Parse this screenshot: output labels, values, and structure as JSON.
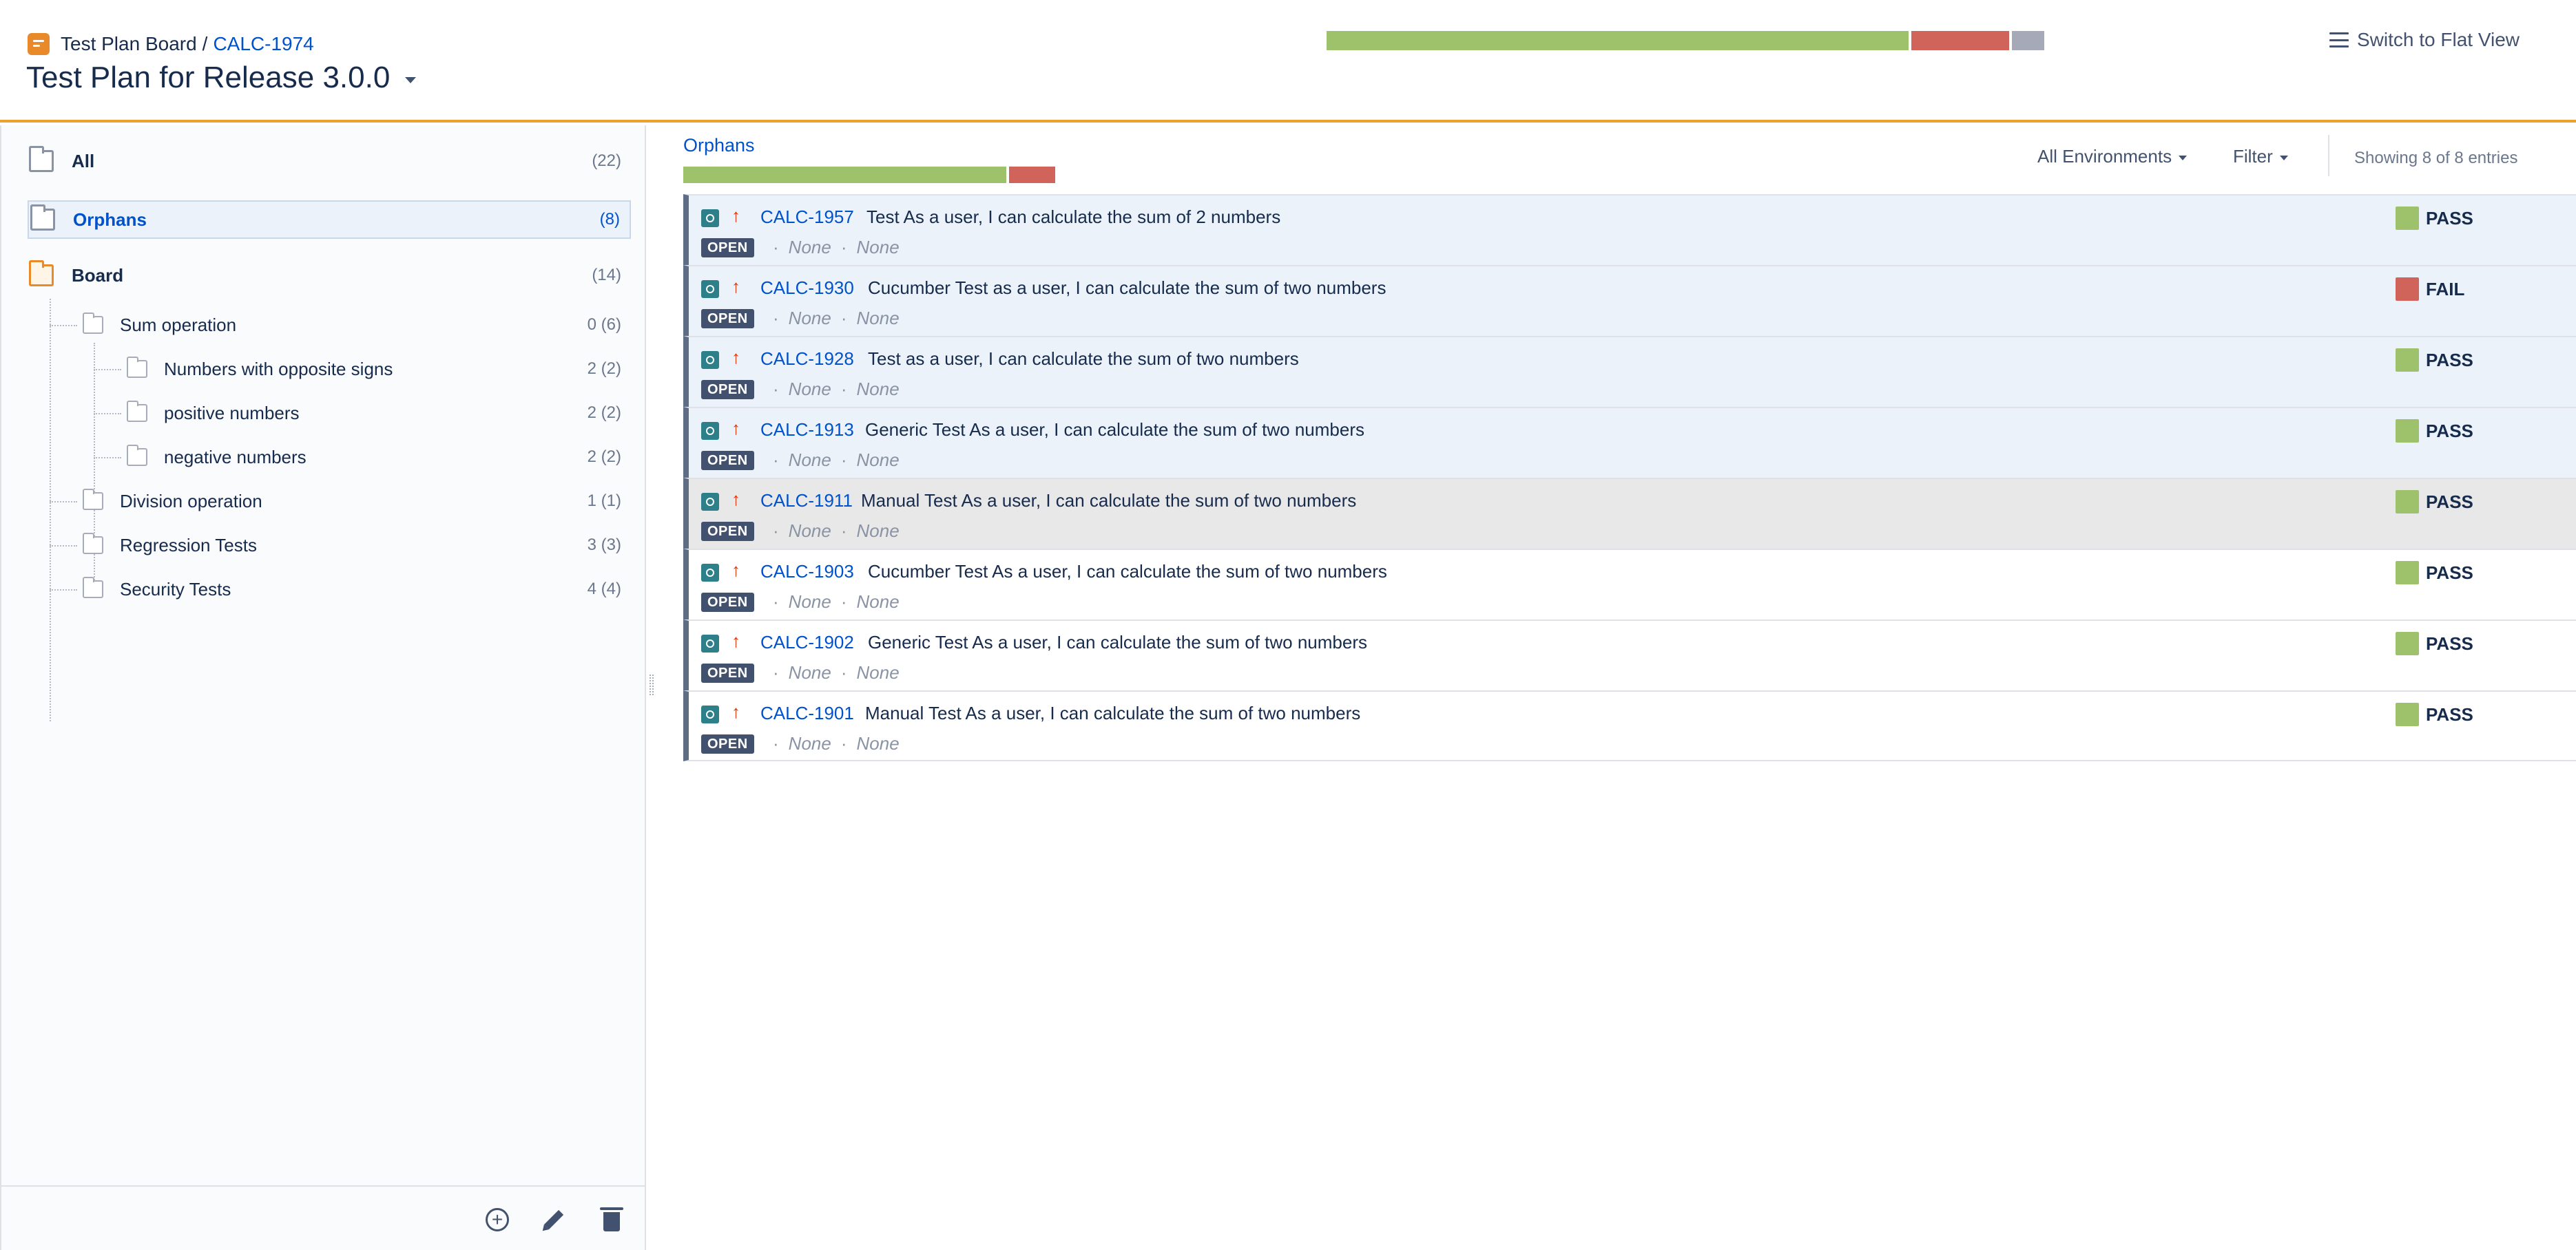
{
  "header": {
    "board_label": "Test Plan Board",
    "separator": "/",
    "issue_key": "CALC-1974",
    "plan_title": "Test Plan for Release 3.0.0",
    "flat_view_label": "Switch to Flat View",
    "progress": [
      {
        "status": "pass",
        "fraction": 0.817,
        "color": "#9ec26b"
      },
      {
        "status": "fail",
        "fraction": 0.138,
        "color": "#d0645a"
      },
      {
        "status": "other",
        "fraction": 0.045,
        "color": "#a5a9b8"
      }
    ]
  },
  "sidebar": {
    "all": {
      "label": "All",
      "count": "(22)"
    },
    "orphans": {
      "label": "Orphans",
      "count": "(8)"
    },
    "board": {
      "label": "Board",
      "count": "(14)"
    },
    "folders": [
      {
        "label": "Sum operation",
        "count": "0 (6)"
      },
      {
        "label": "Numbers with opposite signs",
        "count": "2 (2)"
      },
      {
        "label": "positive numbers",
        "count": "2 (2)"
      },
      {
        "label": "negative numbers",
        "count": "2 (2)"
      },
      {
        "label": "Division operation",
        "count": "1 (1)"
      },
      {
        "label": "Regression Tests",
        "count": "3 (3)"
      },
      {
        "label": "Security Tests",
        "count": "4 (4)"
      }
    ]
  },
  "main": {
    "section_title": "Orphans",
    "progress": [
      {
        "status": "pass",
        "fraction": 0.875,
        "color": "#9ec26b"
      },
      {
        "status": "fail",
        "fraction": 0.125,
        "color": "#d0645a"
      }
    ],
    "environment_filter": "All Environments",
    "filter_label": "Filter",
    "showing": "Showing 8 of 8 entries",
    "tests": [
      {
        "key": "CALC-1957",
        "summary": "Test As a user, I can calculate the sum of 2 numbers",
        "status_badge": "OPEN",
        "meta1": "None",
        "meta2": "None",
        "result": "PASS",
        "result_color": "#9ec26b"
      },
      {
        "key": "CALC-1930",
        "summary": "Cucumber Test as a user, I can calculate the sum of two numbers",
        "status_badge": "OPEN",
        "meta1": "None",
        "meta2": "None",
        "result": "FAIL",
        "result_color": "#d0645a"
      },
      {
        "key": "CALC-1928",
        "summary": "Test as a user, I can calculate the sum of two numbers",
        "status_badge": "OPEN",
        "meta1": "None",
        "meta2": "None",
        "result": "PASS",
        "result_color": "#9ec26b"
      },
      {
        "key": "CALC-1913",
        "summary": "Generic Test As a user, I can calculate the sum of two numbers",
        "status_badge": "OPEN",
        "meta1": "None",
        "meta2": "None",
        "result": "PASS",
        "result_color": "#9ec26b"
      },
      {
        "key": "CALC-1911",
        "summary": "Manual Test As a user, I can calculate the sum of two numbers",
        "status_badge": "OPEN",
        "meta1": "None",
        "meta2": "None",
        "result": "PASS",
        "result_color": "#9ec26b"
      },
      {
        "key": "CALC-1903",
        "summary": "Cucumber Test As a user, I can calculate the sum of two numbers",
        "status_badge": "OPEN",
        "meta1": "None",
        "meta2": "None",
        "result": "PASS",
        "result_color": "#9ec26b"
      },
      {
        "key": "CALC-1902",
        "summary": "Generic Test As a user, I can calculate the sum of two numbers",
        "status_badge": "OPEN",
        "meta1": "None",
        "meta2": "None",
        "result": "PASS",
        "result_color": "#9ec26b"
      },
      {
        "key": "CALC-1901",
        "summary": "Manual Test As a user, I can calculate the sum of two numbers",
        "status_badge": "OPEN",
        "meta1": "None",
        "meta2": "None",
        "result": "PASS",
        "result_color": "#9ec26b"
      }
    ]
  },
  "icons": {
    "board": "board-icon",
    "priority": "arrow-up-icon",
    "test_type": "test-icon",
    "folder": "folder-icon",
    "add": "add-icon",
    "edit": "pencil-icon",
    "delete": "trash-icon",
    "flat_view": "list-icon"
  }
}
